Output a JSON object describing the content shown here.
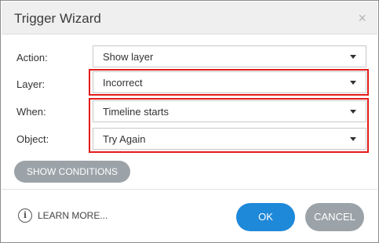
{
  "dialog": {
    "title": "Trigger Wizard",
    "close_symbol": "×"
  },
  "fields": {
    "action": {
      "label": "Action:",
      "value": "Show layer"
    },
    "layer": {
      "label": "Layer:",
      "value": "Incorrect"
    },
    "when": {
      "label": "When:",
      "value": "Timeline starts"
    },
    "object": {
      "label": "Object:",
      "value": "Try Again"
    }
  },
  "buttons": {
    "show_conditions": "SHOW CONDITIONS",
    "learn_more": "LEARN MORE...",
    "ok": "OK",
    "cancel": "CANCEL"
  },
  "icons": {
    "info": "i"
  },
  "colors": {
    "highlight": "#e31b1b",
    "primary": "#1e88d9",
    "secondary": "#9ba3a8"
  }
}
